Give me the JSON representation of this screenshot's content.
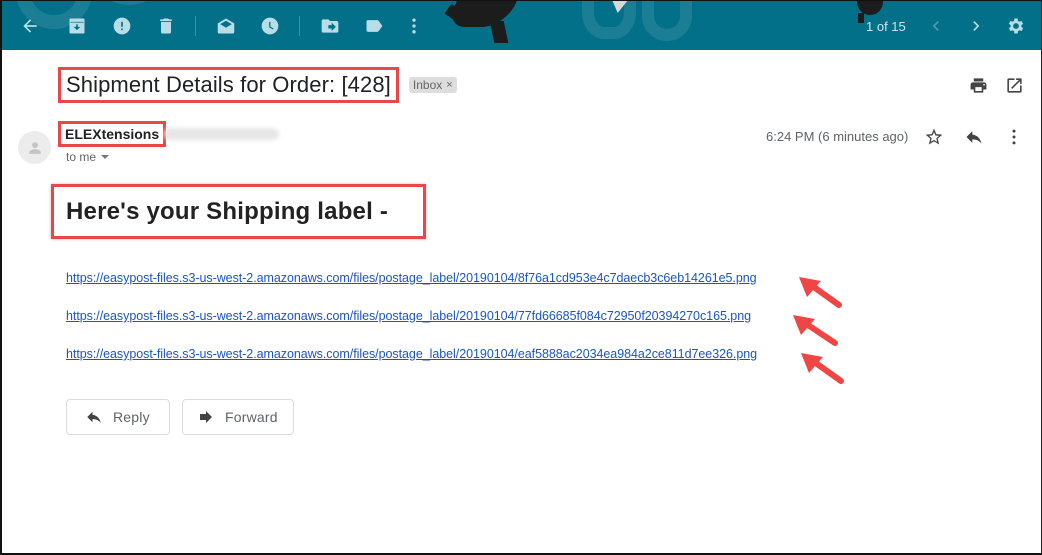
{
  "toolbar": {
    "icons": [
      "back-arrow-icon",
      "archive-icon",
      "report-spam-icon",
      "delete-icon",
      "mark-unread-icon",
      "snooze-icon",
      "move-to-icon",
      "label-icon",
      "more-vertical-icon"
    ],
    "pager": "1 of 15",
    "pager_prev": "newer-chevron-left-icon",
    "pager_next": "older-chevron-right-icon",
    "settings": "settings-gear-icon"
  },
  "email": {
    "subject": "Shipment Details for Order: [428]",
    "label_chip": "Inbox",
    "label_chip_remove": "×",
    "print": "print-icon",
    "open_new_window": "open-in-new-window-icon",
    "sender_name": "ELEXtensions",
    "recipient": "to me",
    "timestamp": "6:24 PM (6 minutes ago)",
    "body_heading": "Here's your Shipping label -",
    "links": [
      "https://easypost-files.s3-us-west-2.amazonaws.com/files/postage_label/20190104/8f76a1cd953e4c7daecb3c6eb14261e5.png",
      "https://easypost-files.s3-us-west-2.amazonaws.com/files/postage_label/20190104/77fd66685f084c72950f20394270c165.png",
      "https://easypost-files.s3-us-west-2.amazonaws.com/files/postage_label/20190104/eaf5888ac2034ea984a2ce811d7ee326.png"
    ]
  },
  "actions": {
    "reply": "Reply",
    "forward": "Forward"
  },
  "colors": {
    "toolbar_bg": "#027089",
    "highlight_red": "#e84848",
    "link_blue": "#1a55c7"
  }
}
